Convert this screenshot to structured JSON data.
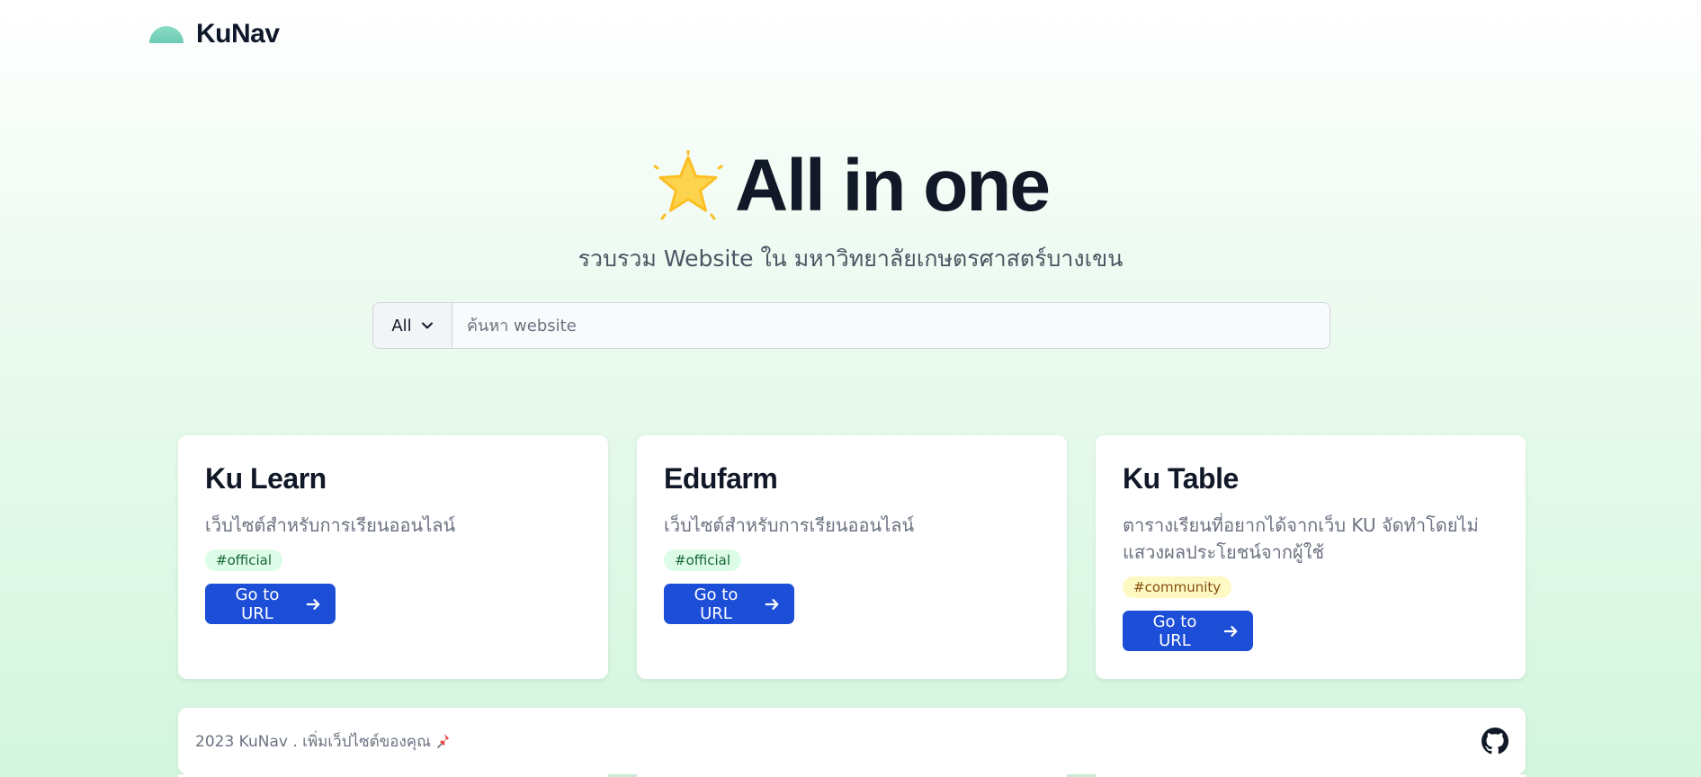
{
  "header": {
    "logo_text": "KuNav"
  },
  "hero": {
    "title": "All in one",
    "subtitle": "รวบรวม Website ใน มหาวิทยาลัยเกษตรศาสตร์บางเขน"
  },
  "search": {
    "filter_value": "All",
    "placeholder": "ค้นหา website"
  },
  "cards": [
    {
      "title": "Ku Learn",
      "description": "เว็บไซต์สำหรับการเรียนออนไลน์",
      "tag": "#official",
      "button_label": "Go to URL"
    },
    {
      "title": "Edufarm",
      "description": "เว็บไซต์สำหรับการเรียนออนไลน์",
      "tag": "#official",
      "button_label": "Go to URL"
    },
    {
      "title": "Ku Table",
      "description": "ตารางเรียนที่อยากได้จากเว็บ KU จัดทำโดยไม่แสวงผลประโยชน์จากผู้ใช้",
      "tag": "#community",
      "button_label": "Go to URL"
    }
  ],
  "footer": {
    "text": "2023 KuNav . เพิ่มเว็ปไซต์ของคุณ"
  },
  "icons": {
    "hero": "star-icon",
    "footer_pin": "pin-icon",
    "footer_repo": "github-icon",
    "button": "arrow-right-icon",
    "select": "chevron-down-icon"
  },
  "colors": {
    "primary_button": "#1d4ed8",
    "official_tag_bg": "#dcfce7",
    "community_tag_bg": "#fef9c3",
    "logo_mint": "#7fd6c0"
  }
}
